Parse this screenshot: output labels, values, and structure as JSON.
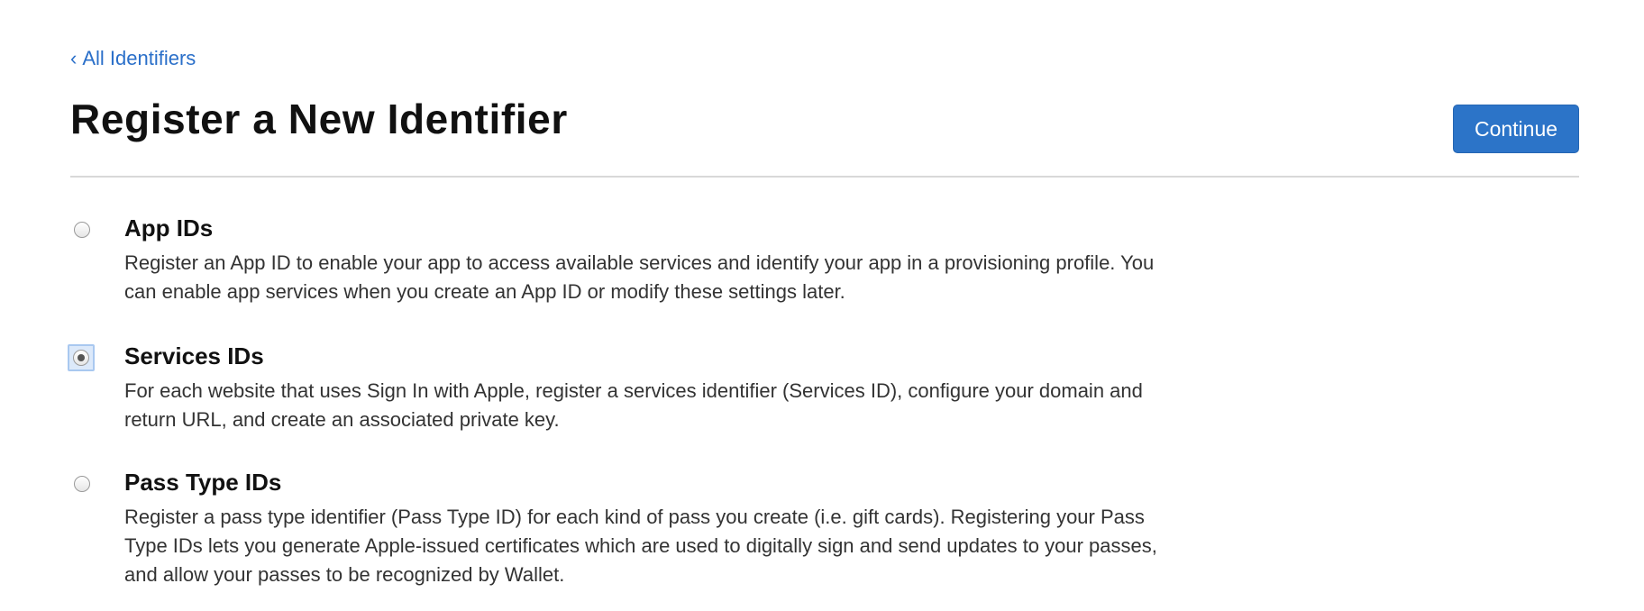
{
  "nav": {
    "back_chevron": "‹",
    "back_label": "All Identifiers"
  },
  "header": {
    "title": "Register a New Identifier",
    "continue_label": "Continue"
  },
  "colors": {
    "accent": "#2c74c8",
    "link": "#2a6fc9",
    "focus_ring": "#a9c8f0"
  },
  "options": [
    {
      "title": "App IDs",
      "description": "Register an App ID to enable your app to access available services and identify your app in a provisioning profile. You can enable app services when you create an App ID or modify these settings later.",
      "selected": false
    },
    {
      "title": "Services IDs",
      "description": "For each website that uses Sign In with Apple, register a services identifier (Services ID), configure your domain and return URL, and create an associated private key.",
      "selected": true
    },
    {
      "title": "Pass Type IDs",
      "description": "Register a pass type identifier (Pass Type ID) for each kind of pass you create (i.e. gift cards). Registering your Pass Type IDs lets you generate Apple-issued certificates which are used to digitally sign and send updates to your passes, and allow your passes to be recognized by Wallet.",
      "selected": false
    }
  ]
}
